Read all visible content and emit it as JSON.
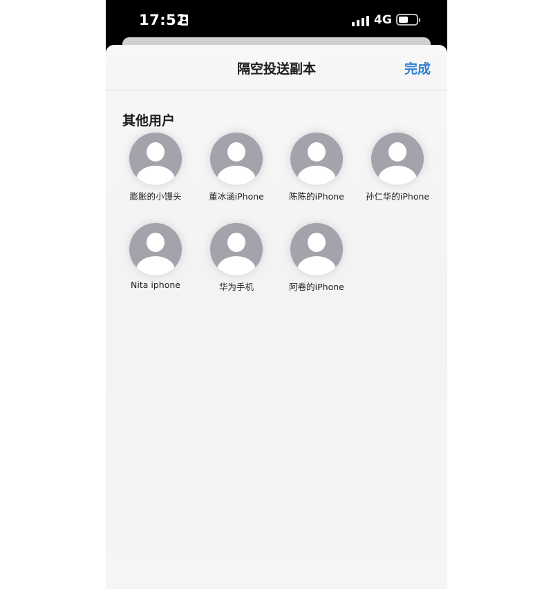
{
  "status_bar": {
    "time": "17:52",
    "network": "4G"
  },
  "nav": {
    "title": "隔空投送副本",
    "done_label": "完成"
  },
  "section": {
    "title": "其他用户"
  },
  "contacts": [
    {
      "name": "膨胀的小馒头"
    },
    {
      "name": "董冰涵iPhone"
    },
    {
      "name": "陈陈的iPhone"
    },
    {
      "name": "孙仁华的iPhone"
    },
    {
      "name": "Nita iphone"
    },
    {
      "name": "华为手机"
    },
    {
      "name": "阿卷的iPhone"
    }
  ],
  "colors": {
    "accent": "#2f7fd1",
    "avatar": "#a2a3ab",
    "sheet_background": "#f4f4f4"
  },
  "icons": [
    "id-card-icon",
    "signal-icon",
    "battery-icon",
    "person-icon"
  ]
}
